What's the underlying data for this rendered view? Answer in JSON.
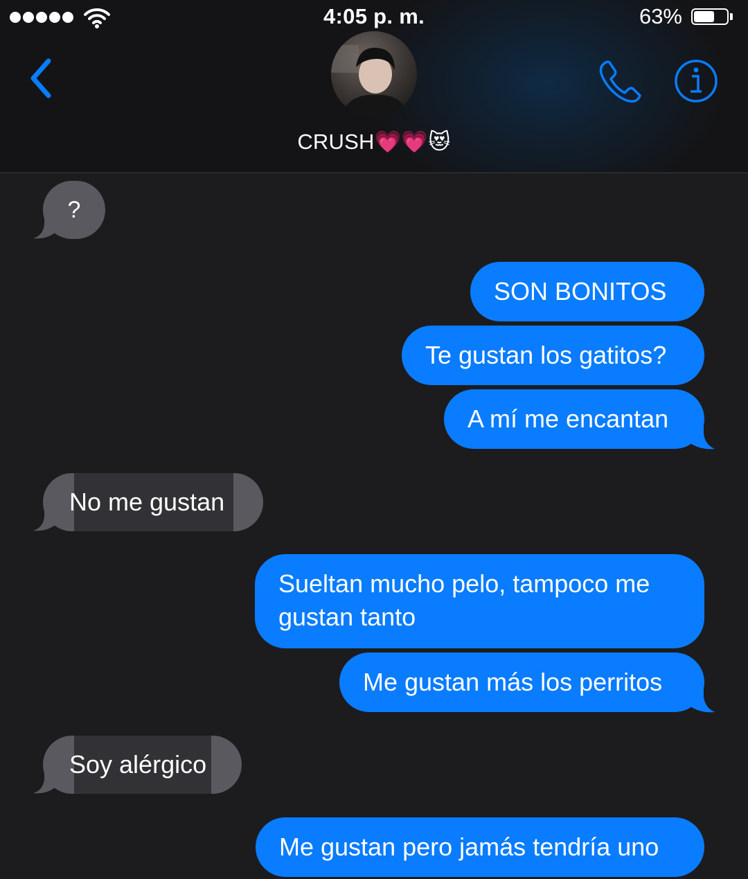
{
  "status_bar": {
    "time": "4:05 p. m.",
    "battery_percent": "63%",
    "battery_level": 0.63,
    "signal_bars": 5
  },
  "nav": {
    "contact_name": "CRUSH💗💗😻",
    "icons": [
      "back-chevron-icon",
      "phone-icon",
      "info-icon"
    ],
    "accent_color": "#0a7cff"
  },
  "messages": [
    {
      "sender": "contact",
      "text": "?"
    },
    {
      "sender": "me",
      "text": "SON BONITOS"
    },
    {
      "sender": "me",
      "text": "Te gustan los gatitos?"
    },
    {
      "sender": "me",
      "text": "A mí me encantan"
    },
    {
      "sender": "contact",
      "text": "No me gustan"
    },
    {
      "sender": "me",
      "text": "Sueltan mucho pelo, tampoco me",
      "text_line2": "gustan tanto"
    },
    {
      "sender": "me",
      "text": "Me gustan más los perritos"
    },
    {
      "sender": "contact",
      "text": "Soy alérgico"
    },
    {
      "sender": "me",
      "text": "Me gustan pero jamás tendría uno"
    }
  ],
  "colors": {
    "outgoing_bubble": "#0a7cff",
    "incoming_bubble": "#5a595f",
    "background": "#1c1c1e"
  }
}
